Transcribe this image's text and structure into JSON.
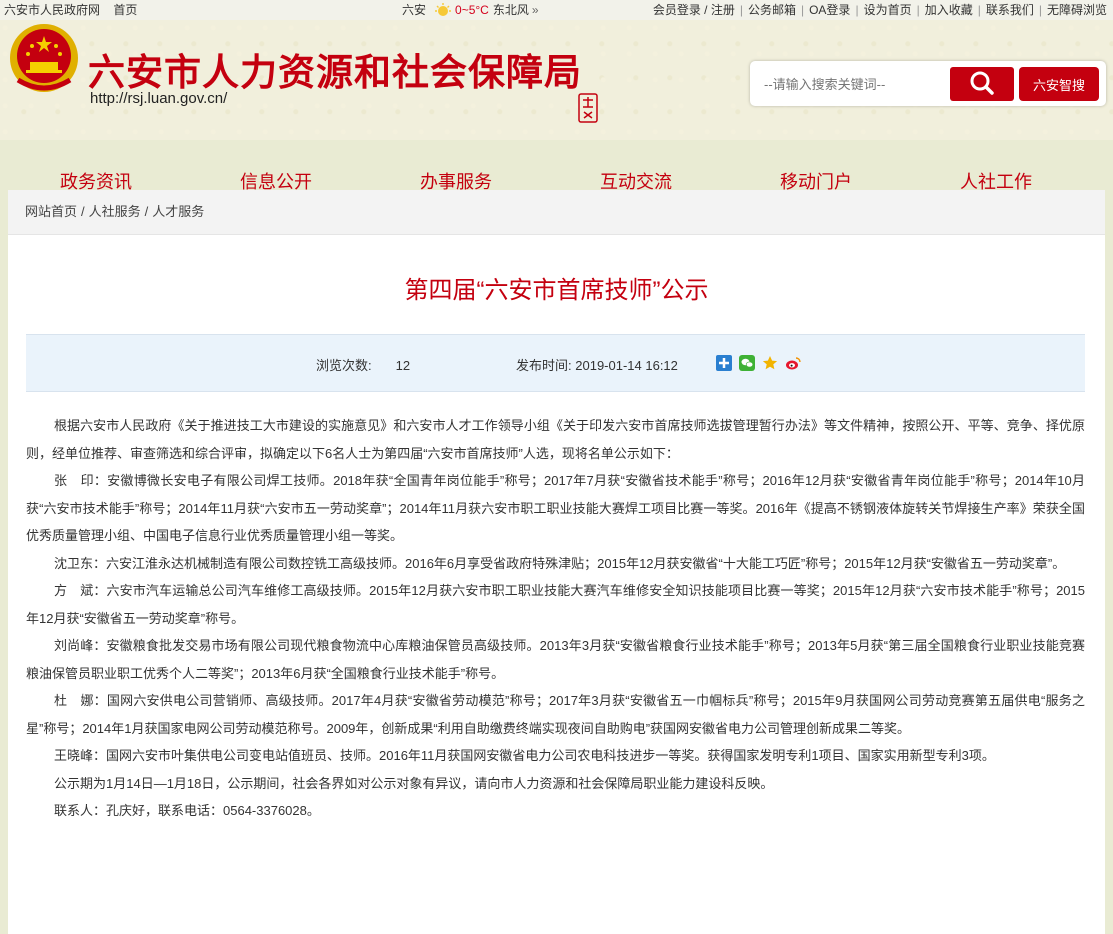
{
  "topbar": {
    "gov_link": "六安市人民政府网",
    "home_link": "首页",
    "city": "六安",
    "temperature": "0~5°C",
    "wind": "东北风",
    "links": [
      "会员登录 / 注册",
      "公务邮箱",
      "OA登录",
      "设为首页",
      "加入收藏",
      "联系我们",
      "无障碍浏览"
    ]
  },
  "header": {
    "title": "六安市人力资源和社会保障局",
    "url": "http://rsj.luan.gov.cn/",
    "search_placeholder": "--请输入搜索关键词--",
    "smart_search_label": "六安智搜"
  },
  "nav": [
    "政务资讯",
    "信息公开",
    "办事服务",
    "互动交流",
    "移动门户",
    "人社工作"
  ],
  "breadcrumb": [
    "网站首页",
    "人社服务",
    "人才服务"
  ],
  "article": {
    "title": "第四届“六安市首席技师”公示",
    "views_label": "浏览次数:",
    "views_value": "12",
    "date_label": "发布时间:",
    "date_value": "2019-01-14 16:12",
    "paragraphs": [
      "根据六安市人民政府《关于推进技工大市建设的实施意见》和六安市人才工作领导小组《关于印发六安市首席技师选拔管理暂行办法》等文件精神，按照公开、平等、竞争、择优原则，经单位推荐、审查筛选和综合评审，拟确定以下6名人士为第四届“六安市首席技师”人选，现将名单公示如下：",
      "张　印：安徽博微长安电子有限公司焊工技师。2018年获“全国青年岗位能手”称号；2017年7月获“安徽省技术能手”称号；2016年12月获“安徽省青年岗位能手”称号；2014年10月获“六安市技术能手”称号；2014年11月获“六安市五一劳动奖章”；2014年11月获六安市职工职业技能大赛焊工项目比赛一等奖。2016年《提高不锈钢液体旋转关节焊接生产率》荣获全国优秀质量管理小组、中国电子信息行业优秀质量管理小组一等奖。",
      "沈卫东：六安江淮永达机械制造有限公司数控铣工高级技师。2016年6月享受省政府特殊津贴；2015年12月获安徽省“十大能工巧匠”称号；2015年12月获“安徽省五一劳动奖章”。",
      "方　斌：六安市汽车运输总公司汽车维修工高级技师。2015年12月获六安市职工职业技能大赛汽车维修安全知识技能项目比赛一等奖；2015年12月获“六安市技术能手”称号；2015年12月获“安徽省五一劳动奖章”称号。",
      "刘尚峰：安徽粮食批发交易市场有限公司现代粮食物流中心库粮油保管员高级技师。2013年3月获“安徽省粮食行业技术能手”称号；2013年5月获“第三届全国粮食行业职业技能竞赛粮油保管员职业职工优秀个人二等奖”；2013年6月获“全国粮食行业技术能手”称号。",
      "杜　娜：国网六安供电公司营销师、高级技师。2017年4月获“安徽省劳动模范”称号；2017年3月获“安徽省五一巾帼标兵”称号；2015年9月获国网公司劳动竞赛第五届供电“服务之星”称号；2014年1月获国家电网公司劳动模范称号。2009年，创新成果“利用自助缴费终端实现夜间自助购电”获国网安徽省电力公司管理创新成果二等奖。",
      "王晓峰：国网六安市叶集供电公司变电站值班员、技师。2016年11月获国网安徽省电力公司农电科技进步一等奖。获得国家发明专利1项目、国家实用新型专利3项。",
      "公示期为1月14日—1月18日，公示期间，社会各界如对公示对象有异议，请向市人力资源和社会保障局职业能力建设科反映。",
      "联系人：孔庆好，联系电话：0564-3376028。"
    ]
  },
  "colors": {
    "brand_red": "#c4000f",
    "meta_bg": "#eaf3fb",
    "page_bg": "#f1efdc"
  }
}
